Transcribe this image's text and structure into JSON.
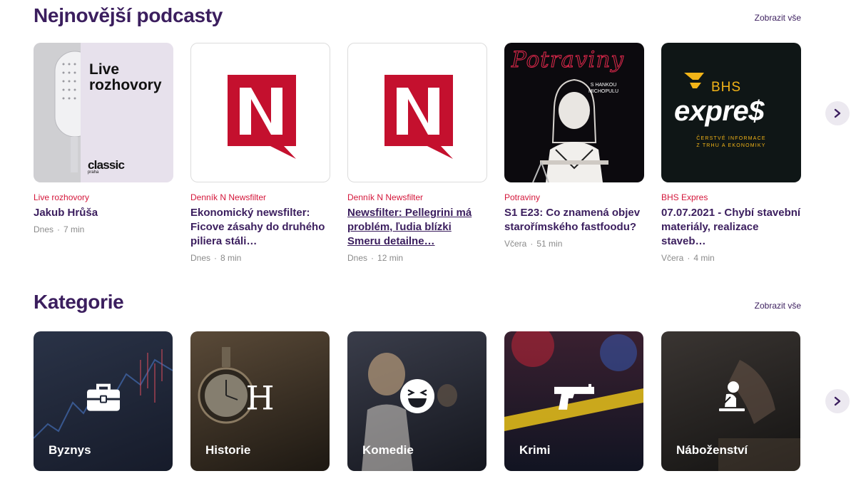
{
  "podcasts": {
    "title": "Nejnovější podcasty",
    "see_all": "Zobrazit vše",
    "items": [
      {
        "show": "Live rozhovory",
        "title": "Jakub Hrůša",
        "date": "Dnes",
        "duration": "7 min",
        "cover_text_1": "Live",
        "cover_text_2": "rozhovory",
        "cover_logo": "classic",
        "cover_logo_sub": "praha"
      },
      {
        "show": "Denník N Newsfilter",
        "title": "Ekonomický newsfilter: Ficove zásahy do druhého piliera stáli…",
        "date": "Dnes",
        "duration": "8 min"
      },
      {
        "show": "Denník N Newsfilter",
        "title": "Newsfilter: Pellegrini má problém, ľudia blízki Smeru detailne…",
        "date": "Dnes",
        "duration": "12 min"
      },
      {
        "show": "Potraviny",
        "title": "S1 E23: Co znamená objev starořímského fastfoodu?",
        "date": "Včera",
        "duration": "51 min",
        "cover_text_1": "Potraviny",
        "cover_text_2": "S HANKOU",
        "cover_text_3": "MICHOPULU"
      },
      {
        "show": "BHS Expres",
        "title": "07.07.2021 - Chybí stavební materiály, realizace staveb…",
        "date": "Včera",
        "duration": "4 min",
        "cover_text_1": "BHS",
        "cover_text_2": "expre$",
        "cover_text_3": "ČERSTVÉ INFORMACE",
        "cover_text_4": "Z TRHU A EKONOMIKY"
      }
    ]
  },
  "categories": {
    "title": "Kategorie",
    "see_all": "Zobrazit vše",
    "items": [
      {
        "label": "Byznys",
        "icon": "briefcase-icon"
      },
      {
        "label": "Historie",
        "icon": "letter-h-icon"
      },
      {
        "label": "Komedie",
        "icon": "laughing-face-icon"
      },
      {
        "label": "Krimi",
        "icon": "pistol-icon"
      },
      {
        "label": "Náboženství",
        "icon": "praying-person-icon"
      }
    ]
  },
  "colors": {
    "accent": "#3b1e5e",
    "show": "#d4163a",
    "dennik_n_red": "#c4102e"
  }
}
